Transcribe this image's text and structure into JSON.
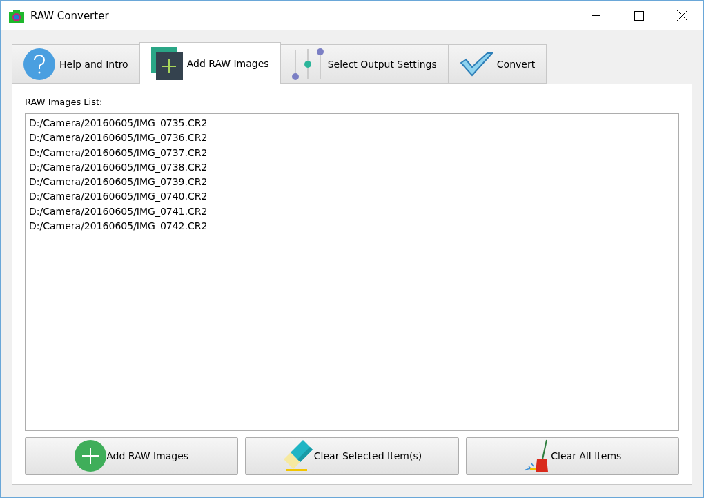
{
  "window": {
    "title": "RAW Converter"
  },
  "tabs": [
    {
      "label": "Help and Intro",
      "kind": "help",
      "selected": false
    },
    {
      "label": "Add RAW Images",
      "kind": "add",
      "selected": true
    },
    {
      "label": "Select Output Settings",
      "kind": "settings",
      "selected": false
    },
    {
      "label": "Convert",
      "kind": "convert",
      "selected": false
    }
  ],
  "list": {
    "label": "RAW Images List:",
    "items": [
      "D:/Camera/20160605/IMG_0735.CR2",
      "D:/Camera/20160605/IMG_0736.CR2",
      "D:/Camera/20160605/IMG_0737.CR2",
      "D:/Camera/20160605/IMG_0738.CR2",
      "D:/Camera/20160605/IMG_0739.CR2",
      "D:/Camera/20160605/IMG_0740.CR2",
      "D:/Camera/20160605/IMG_0741.CR2",
      "D:/Camera/20160605/IMG_0742.CR2"
    ]
  },
  "buttons": [
    {
      "label": "Add RAW Images",
      "kind": "add"
    },
    {
      "label": "Clear Selected Item(s)",
      "kind": "eraser"
    },
    {
      "label": "Clear All Items",
      "kind": "broom"
    }
  ]
}
